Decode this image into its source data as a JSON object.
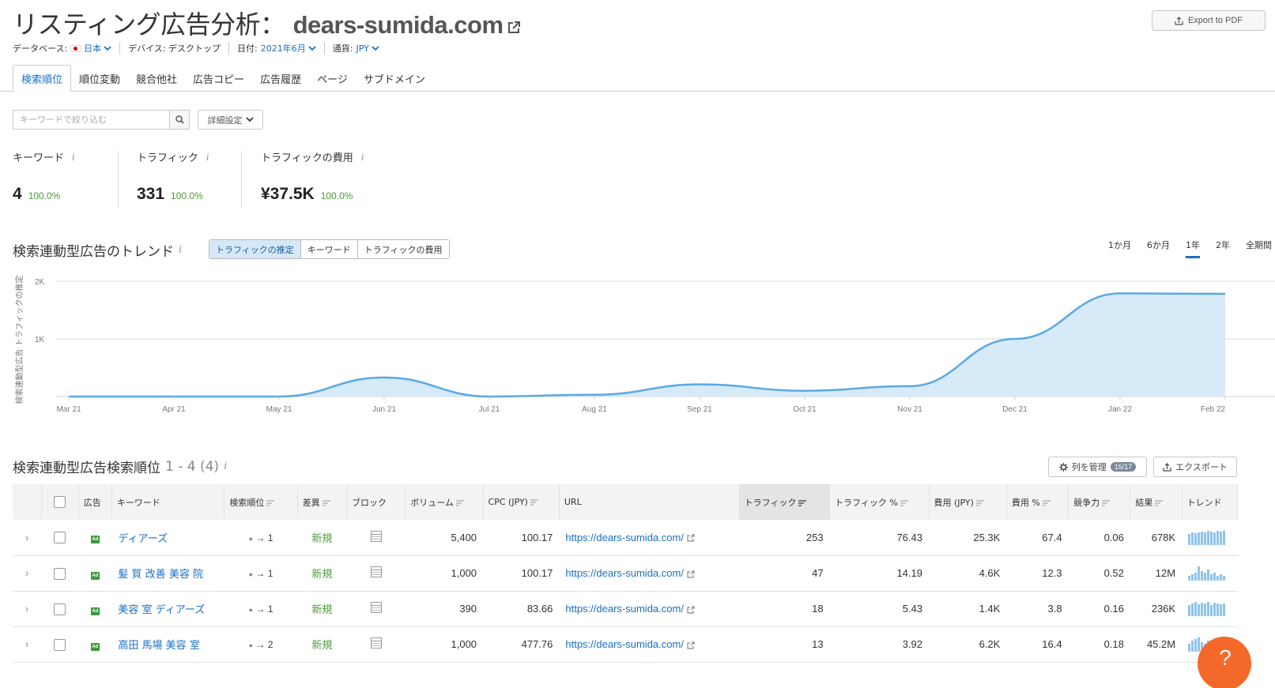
{
  "header": {
    "title": "リスティング広告分析：",
    "domain": "dears-sumida.com",
    "export_pdf_label": "Export to PDF"
  },
  "filters": {
    "database_label": "データベース:",
    "database_value": "日本",
    "device_label": "デバイス: デスクトップ",
    "date_label": "日付:",
    "date_value": "2021年6月",
    "currency_label": "通貨:",
    "currency_value": "JPY"
  },
  "tabs": [
    {
      "label": "検索順位",
      "active": true
    },
    {
      "label": "順位変動"
    },
    {
      "label": "競合他社"
    },
    {
      "label": "広告コピー"
    },
    {
      "label": "広告履歴"
    },
    {
      "label": "ページ"
    },
    {
      "label": "サブドメイン"
    }
  ],
  "search": {
    "placeholder": "キーワードで絞り込む",
    "advanced_label": "詳細設定"
  },
  "summary": [
    {
      "label": "キーワード",
      "value": "4",
      "pct": "100.0%"
    },
    {
      "label": "トラフィック",
      "value": "331",
      "pct": "100.0%"
    },
    {
      "label": "トラフィックの費用",
      "value": "¥37.5K",
      "pct": "100.0%"
    }
  ],
  "trend": {
    "title": "検索連動型広告のトレンド",
    "metric_options": [
      "トラフィックの推定",
      "キーワード",
      "トラフィックの費用"
    ],
    "metric_active": "トラフィックの推定",
    "periods": [
      "1か月",
      "6か月",
      "1年",
      "2年",
      "全期間"
    ],
    "period_active": "1年"
  },
  "chart_data": {
    "type": "area",
    "ylabel": "検索連動型広告 トラフィックの推定",
    "y_ticks": [
      "2K",
      "1K"
    ],
    "ylim": [
      0,
      2000
    ],
    "x": [
      "Mar 21",
      "Apr 21",
      "May 21",
      "Jun 21",
      "Jul 21",
      "Aug 21",
      "Sep 21",
      "Oct 21",
      "Nov 21",
      "Dec 21",
      "Jan 22",
      "Feb 22"
    ],
    "series": [
      {
        "values": [
          0,
          0,
          0,
          331,
          0,
          30,
          210,
          100,
          180,
          1000,
          1790,
          1780
        ]
      }
    ],
    "grid": true,
    "color": "#5aa9e6",
    "fill": "#d6eaf8"
  },
  "table": {
    "title": "検索連動型広告検索順位",
    "range": "1 - 4 (4)",
    "manage_cols_label": "列を管理",
    "manage_cols_badge": "15/17",
    "export_label": "エクスポート",
    "columns": [
      "広告",
      "キーワード",
      "検索順位",
      "差異",
      "ブロック",
      "ボリューム",
      "CPC (JPY)",
      "URL",
      "トラフィック",
      "トラフィック %",
      "費用 (JPY)",
      "費用 %",
      "競争力",
      "結果",
      "トレンド"
    ],
    "rows": [
      {
        "keyword": "ディアーズ",
        "pos": "1",
        "diff": "新規",
        "volume": "5,400",
        "cpc": "100.17",
        "url": "https://dears-sumida.com/",
        "traffic": "253",
        "traffic_pct": "76.43",
        "cost": "25.3K",
        "cost_pct": "67.4",
        "competition": "0.06",
        "results": "678K",
        "trend": [
          0.7,
          0.8,
          0.75,
          0.8,
          0.85,
          0.8,
          0.9,
          0.85,
          0.8,
          0.9,
          0.85,
          0.9
        ]
      },
      {
        "keyword": "髪 質 改善 美容 院",
        "pos": "1",
        "diff": "新規",
        "volume": "1,000",
        "cpc": "100.17",
        "url": "https://dears-sumida.com/",
        "traffic": "47",
        "traffic_pct": "14.19",
        "cost": "4.6K",
        "cost_pct": "12.3",
        "competition": "0.52",
        "results": "12M",
        "trend": [
          0.3,
          0.4,
          0.5,
          0.9,
          0.6,
          0.5,
          0.7,
          0.4,
          0.5,
          0.3,
          0.4,
          0.3
        ]
      },
      {
        "keyword": "美容 室 ディアーズ",
        "pos": "1",
        "diff": "新規",
        "volume": "390",
        "cpc": "83.66",
        "url": "https://dears-sumida.com/",
        "traffic": "18",
        "traffic_pct": "5.43",
        "cost": "1.4K",
        "cost_pct": "3.8",
        "competition": "0.16",
        "results": "236K",
        "trend": [
          0.7,
          0.8,
          0.9,
          0.75,
          0.85,
          0.8,
          0.9,
          0.7,
          0.85,
          0.8,
          0.75,
          0.8
        ]
      },
      {
        "keyword": "高田 馬場 美容 室",
        "pos": "2",
        "diff": "新規",
        "volume": "1,000",
        "cpc": "477.76",
        "url": "https://dears-sumida.com/",
        "traffic": "13",
        "traffic_pct": "3.92",
        "cost": "6.2K",
        "cost_pct": "16.4",
        "competition": "0.18",
        "results": "45.2M",
        "trend": [
          0.5,
          0.7,
          0.8,
          0.9,
          0.6,
          0.5,
          0.7,
          0.6,
          0.5,
          0.4,
          0.5,
          0.6
        ]
      }
    ]
  },
  "help_label": "?"
}
